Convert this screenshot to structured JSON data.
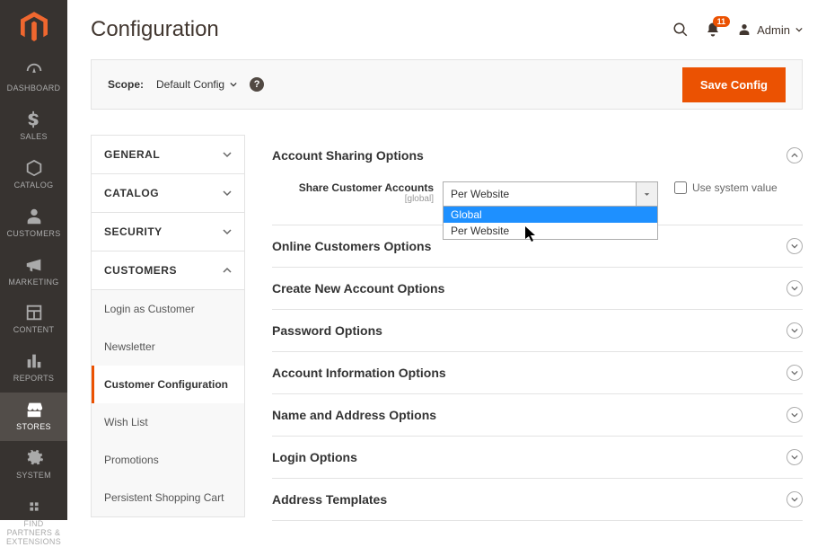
{
  "header": {
    "title": "Configuration",
    "notif_count": "11",
    "admin_label": "Admin"
  },
  "scope": {
    "label": "Scope:",
    "selected": "Default Config",
    "save_label": "Save Config"
  },
  "config_nav": {
    "groups": [
      {
        "label": "GENERAL",
        "expanded": false
      },
      {
        "label": "CATALOG",
        "expanded": false
      },
      {
        "label": "SECURITY",
        "expanded": false
      },
      {
        "label": "CUSTOMERS",
        "expanded": true
      }
    ],
    "customers_items": [
      {
        "label": "Login as Customer",
        "active": false
      },
      {
        "label": "Newsletter",
        "active": false
      },
      {
        "label": "Customer Configuration",
        "active": true
      },
      {
        "label": "Wish List",
        "active": false
      },
      {
        "label": "Promotions",
        "active": false
      },
      {
        "label": "Persistent Shopping Cart",
        "active": false
      }
    ]
  },
  "sections": {
    "account_sharing": {
      "title": "Account Sharing Options",
      "field_label": "Share Customer Accounts",
      "field_scope": "[global]",
      "selected": "Per Website",
      "options": [
        "Global",
        "Per Website"
      ],
      "use_system_label": "Use system value"
    },
    "others": [
      "Online Customers Options",
      "Create New Account Options",
      "Password Options",
      "Account Information Options",
      "Name and Address Options",
      "Login Options",
      "Address Templates"
    ]
  },
  "sidebar": {
    "items": [
      {
        "label": "DASHBOARD"
      },
      {
        "label": "SALES"
      },
      {
        "label": "CATALOG"
      },
      {
        "label": "CUSTOMERS"
      },
      {
        "label": "MARKETING"
      },
      {
        "label": "CONTENT"
      },
      {
        "label": "REPORTS"
      },
      {
        "label": "STORES"
      },
      {
        "label": "SYSTEM"
      },
      {
        "label": "FIND PARTNERS & EXTENSIONS"
      }
    ]
  }
}
